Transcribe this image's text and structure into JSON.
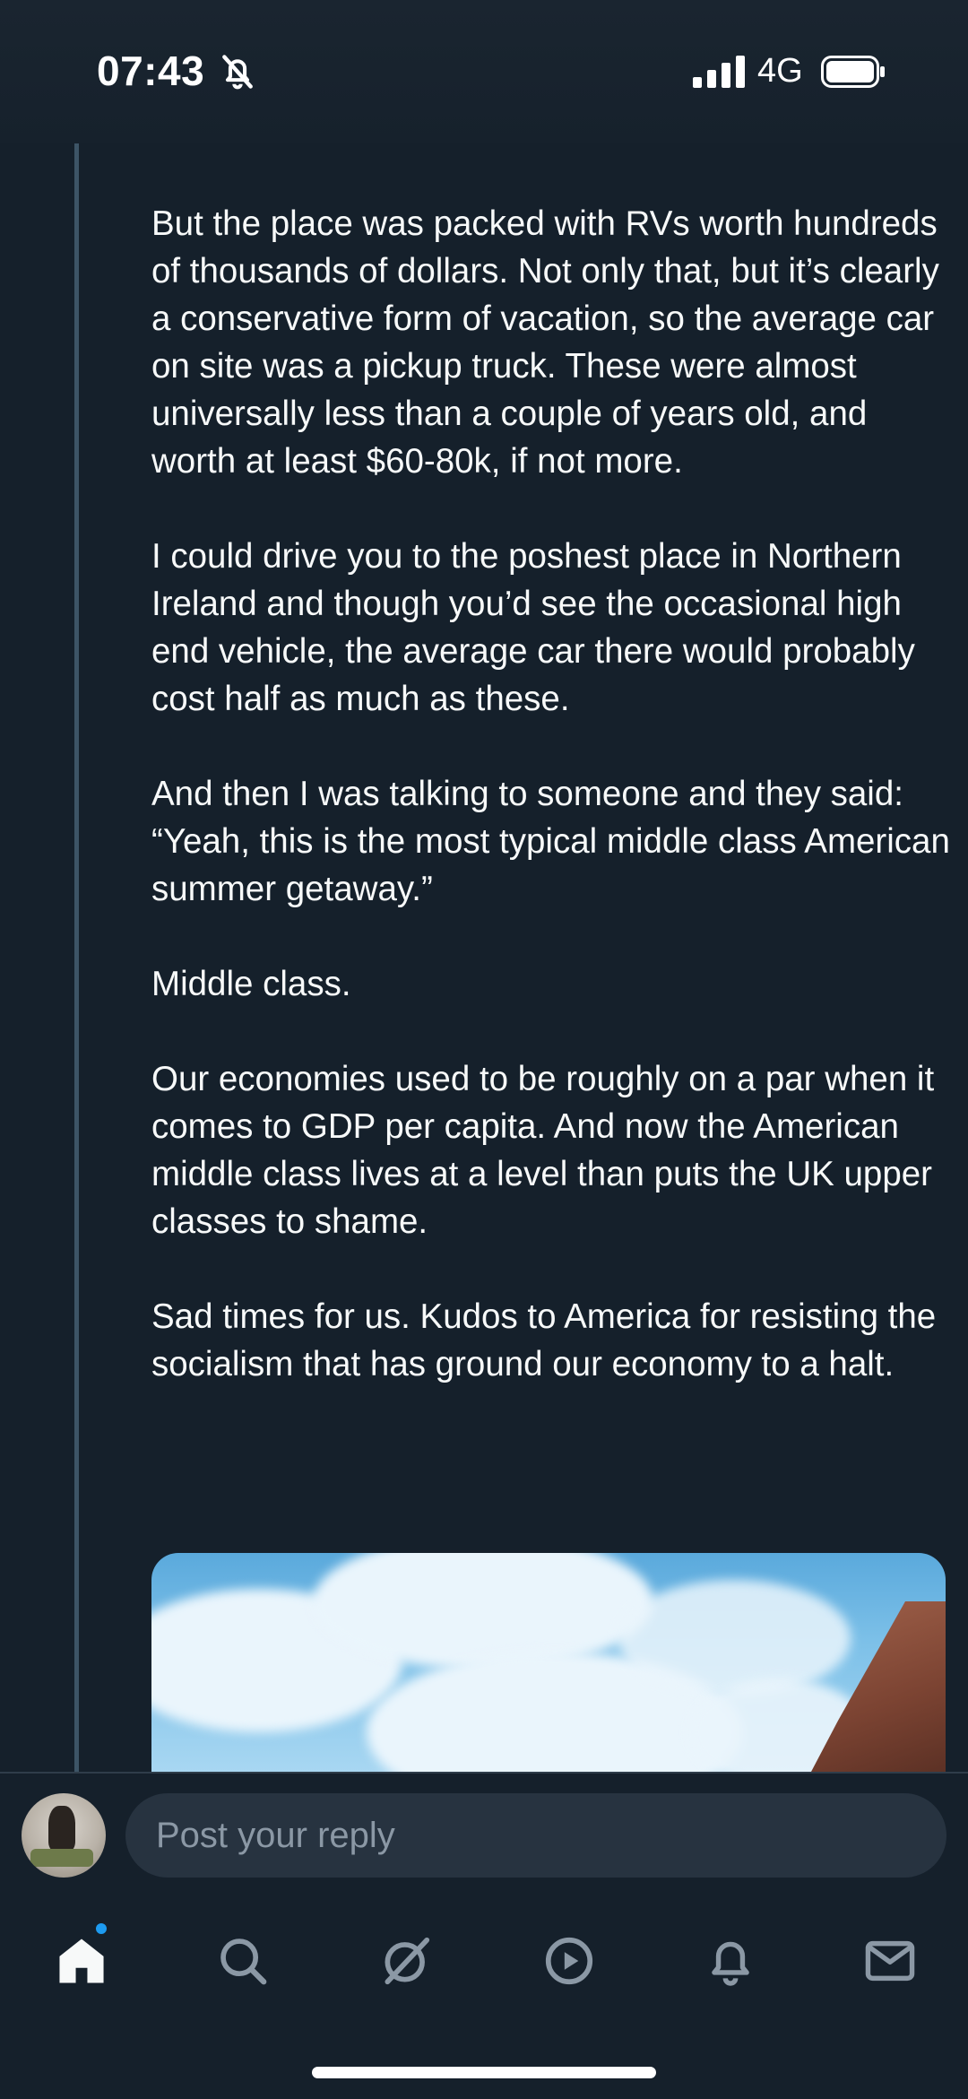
{
  "status_bar": {
    "time": "07:43",
    "network": "4G"
  },
  "post": {
    "paragraphs": [
      "But the place was packed with RVs worth hundreds of thousands of dollars. Not only that, but it’s clearly a conservative form of vacation, so the average car on site was a pickup truck. These were almost universally less than a couple of years old, and worth at least $60-80k, if not more.",
      "I could drive you to the poshest place in Northern Ireland and though you’d see the occasional high end vehicle, the average car there would probably cost half as much as these.",
      "And then I was talking to someone and they said: “Yeah, this is the most typical middle class American summer getaway.”",
      "Middle class.",
      "Our economies used to be roughly on a par when it comes to GDP per capita. And now the American middle class lives at a level than puts the UK upper classes to shame.",
      "Sad times for us. Kudos to America for resisting the socialism that has ground our economy to a halt."
    ]
  },
  "reply": {
    "placeholder": "Post your reply"
  },
  "tab_bar": {
    "items": [
      {
        "icon": "home-icon",
        "active": true,
        "has_badge": true
      },
      {
        "icon": "search-icon",
        "active": false
      },
      {
        "icon": "grok-icon",
        "active": false
      },
      {
        "icon": "video-icon",
        "active": false
      },
      {
        "icon": "notifications-icon",
        "active": false
      },
      {
        "icon": "messages-icon",
        "active": false
      }
    ]
  },
  "colors": {
    "background": "#15202b",
    "text": "#f7f9f9",
    "muted": "#8b98a5",
    "accent": "#1d9bf0",
    "thread_line": "#3d5466"
  }
}
